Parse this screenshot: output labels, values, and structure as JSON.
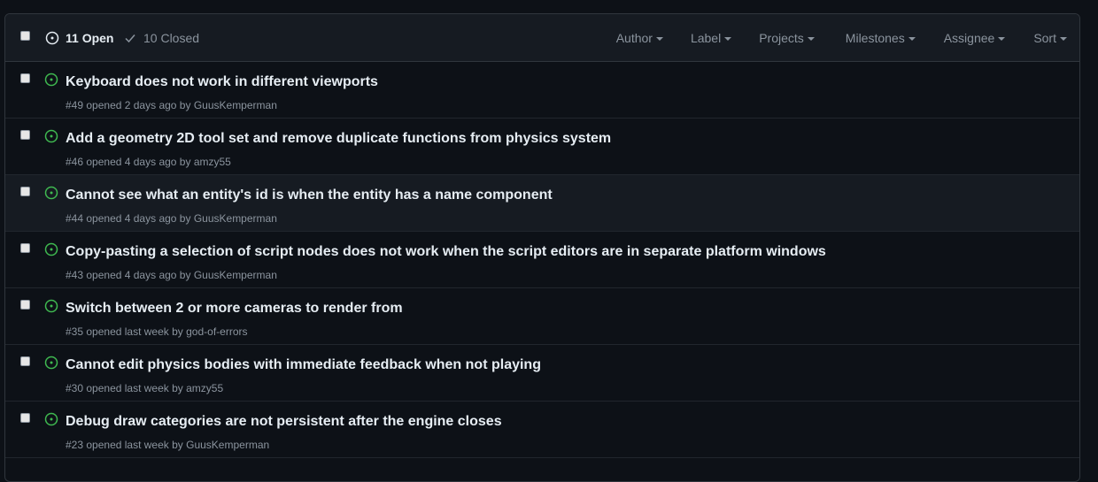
{
  "header": {
    "open_label": "11 Open",
    "closed_label": "10 Closed",
    "filters": [
      {
        "label": "Author"
      },
      {
        "label": "Label"
      },
      {
        "label": "Projects"
      },
      {
        "label": "Milestones"
      },
      {
        "label": "Assignee"
      },
      {
        "label": "Sort"
      }
    ]
  },
  "colors": {
    "open_icon": "#3fb950",
    "background": "#0d1117",
    "header_bg": "#161b22",
    "muted_text": "#8b949e"
  },
  "issues": [
    {
      "title": "Keyboard does not work in different viewports",
      "number": "#49",
      "opened": "opened 2 days ago by",
      "author": "GuusKemperman"
    },
    {
      "title": "Add a geometry 2D tool set and remove duplicate functions from physics system",
      "number": "#46",
      "opened": "opened 4 days ago by",
      "author": "amzy55"
    },
    {
      "title": "Cannot see what an entity's id is when the entity has a name component",
      "number": "#44",
      "opened": "opened 4 days ago by",
      "author": "GuusKemperman"
    },
    {
      "title": "Copy-pasting a selection of script nodes does not work when the script editors are in separate platform windows",
      "number": "#43",
      "opened": "opened 4 days ago by",
      "author": "GuusKemperman"
    },
    {
      "title": "Switch between 2 or more cameras to render from",
      "number": "#35",
      "opened": "opened last week by",
      "author": "god-of-errors"
    },
    {
      "title": "Cannot edit physics bodies with immediate feedback when not playing",
      "number": "#30",
      "opened": "opened last week by",
      "author": "amzy55"
    },
    {
      "title": "Debug draw categories are not persistent after the engine closes",
      "number": "#23",
      "opened": "opened last week by",
      "author": "GuusKemperman"
    }
  ]
}
